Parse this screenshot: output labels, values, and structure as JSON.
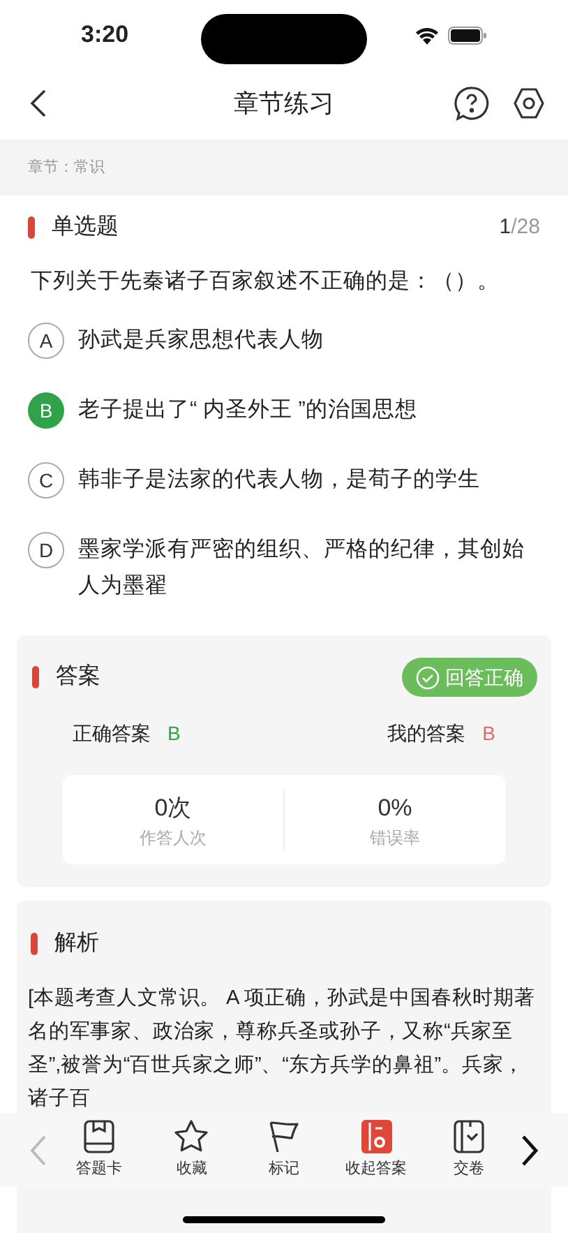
{
  "status_bar": {
    "time": "3:20"
  },
  "header": {
    "title": "章节练习"
  },
  "chapter": {
    "label": "章节：常识"
  },
  "question": {
    "type": "单选题",
    "index": "1",
    "total": "/28",
    "text": "下列关于先秦诸子百家叙述不正确的是：（）。",
    "options": [
      {
        "letter": "A",
        "text": "孙武是兵家思想代表人物",
        "selected": false
      },
      {
        "letter": "B",
        "text": "老子提出了“ 内圣外王 ”的治国思想",
        "selected": true
      },
      {
        "letter": "C",
        "text": "韩非子是法家的代表人物，是荀子的学生",
        "selected": false
      },
      {
        "letter": "D",
        "text": "墨家学派有严密的组织、严格的纪律，其创始人为墨翟",
        "selected": false
      }
    ]
  },
  "answer": {
    "title": "答案",
    "result_badge": "回答正确",
    "correct_label": "正确答案",
    "correct_value": "B",
    "mine_label": "我的答案",
    "mine_value": "B",
    "stats": [
      {
        "value": "0次",
        "label": "作答人次"
      },
      {
        "value": "0%",
        "label": "错误率"
      }
    ]
  },
  "analysis": {
    "title": "解析",
    "text": "[本题考查人文常识。 A 项正确，孙武是中国春秋时期著名的军事家、政治家，尊称兵圣或孙子，又称“兵家至圣”,被誉为“百世兵家之师”、“东方兵学的鼻祖”。兵家，诸子百"
  },
  "toolbar": [
    {
      "label": "答题卡",
      "kind": "card",
      "active": false
    },
    {
      "label": "收藏",
      "kind": "star",
      "active": false
    },
    {
      "label": "标记",
      "kind": "flag",
      "active": false
    },
    {
      "label": "收起答案",
      "kind": "answer",
      "active": true
    },
    {
      "label": "交卷",
      "kind": "submit",
      "active": false
    }
  ]
}
